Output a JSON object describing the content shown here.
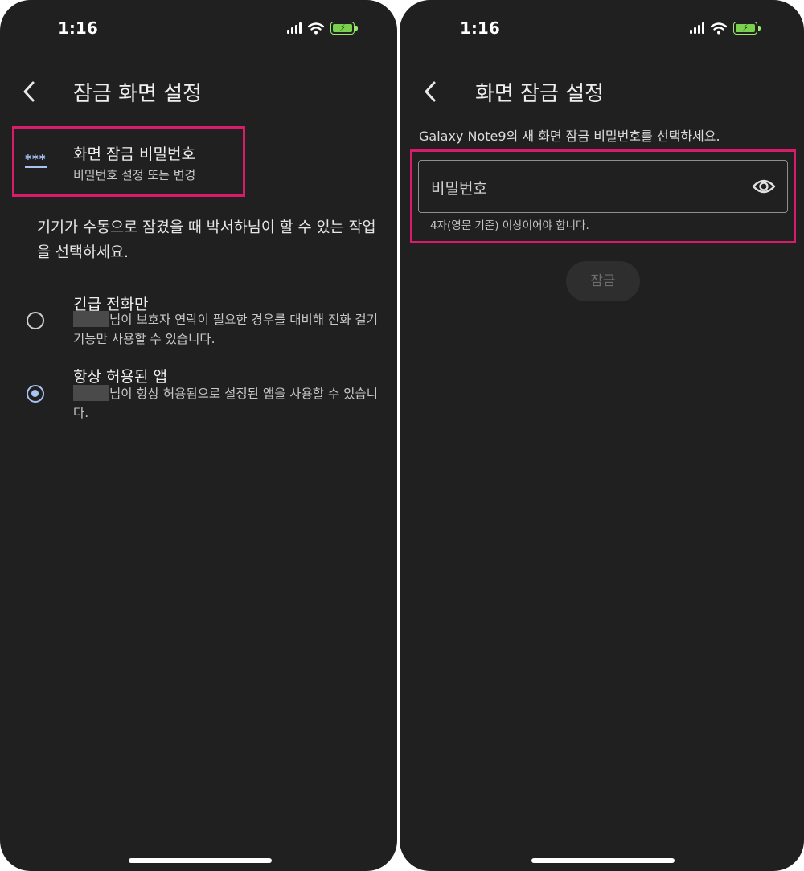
{
  "left": {
    "status": {
      "time": "1:16"
    },
    "header": {
      "title": "잠금 화면 설정"
    },
    "password_item": {
      "icon": "password-dots-icon",
      "icon_text": "***",
      "title": "화면 잠금 비밀번호",
      "subtitle": "비밀번호 설정 또는 변경"
    },
    "description": "기기가 수동으로 잠겼을 때 박서하님이 할 수 있는 작업을 선택하세요.",
    "options": [
      {
        "title": "긴급 전화만",
        "description": "님이 보호자 연락이 필요한 경우를 대비해 전화 걸기 기능만 사용할 수 있습니다.",
        "selected": false
      },
      {
        "title": "항상 허용된 앱",
        "description": "님이 항상 허용됨으로 설정된 앱을 사용할 수 있습니다.",
        "selected": true
      }
    ]
  },
  "right": {
    "status": {
      "time": "1:16"
    },
    "header": {
      "title": "화면 잠금 설정"
    },
    "instruction": "Galaxy Note9의 새 화면 잠금 비밀번호를 선택하세요.",
    "password_field": {
      "placeholder": "비밀번호",
      "value": "",
      "helper": "4자(영문 기준) 이상이어야 합니다."
    },
    "lock_button": {
      "label": "잠금",
      "enabled": false
    }
  },
  "colors": {
    "background": "#202020",
    "highlight": "#d81b6a",
    "accent": "#a7c4f5",
    "battery": "#7ad14c"
  }
}
